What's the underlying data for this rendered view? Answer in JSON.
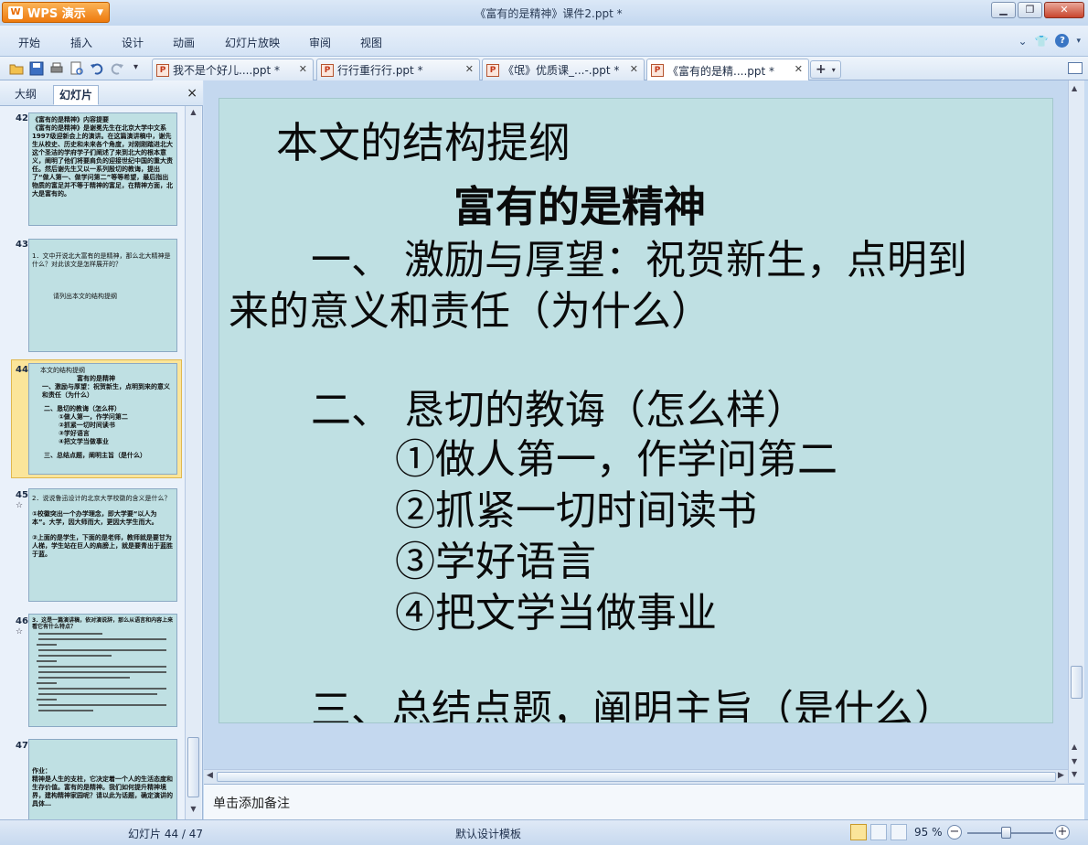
{
  "app": {
    "name": "WPS 演示",
    "window_title": "《富有的是精神》课件2.ppt *"
  },
  "menu": {
    "items": [
      "开始",
      "插入",
      "设计",
      "动画",
      "幻灯片放映",
      "审阅",
      "视图"
    ]
  },
  "doc_tabs": [
    {
      "label": "我不是个好儿....ppt *"
    },
    {
      "label": "行行重行行.ppt *"
    },
    {
      "label": "《氓》优质课_...-.ppt *"
    },
    {
      "label": "《富有的是精....ppt *"
    }
  ],
  "panel": {
    "tab_outline": "大纲",
    "tab_slides": "幻灯片",
    "close": "×"
  },
  "thumbnails": [
    {
      "number": "42",
      "lines": [
        "《富有的是精神》内容提要",
        "《富有的是精神》是谢冕先生在北京大学中文系1997级迎新会上的演讲。在这篇演讲稿中，谢先生从校史、历史和未来各个角度，对刚刚踏进北大这个圣洁的学府学子们阐述了来到北大的根本意义，阐明了他们将要肩负的迎接世纪中国的重大责任。然后谢先生又以一系列殷切的教诲，提出了“做人第一、做学问第二”等等希望，最后指出物质的富足并不等于精神的富足，在精神方面，北大是富有的。"
      ]
    },
    {
      "number": "43",
      "lines": [
        "1．文中开说北大富有的是精神，那么北大精神是什么？对此该文是怎样展开的？",
        "请列出本文的结构提纲"
      ]
    },
    {
      "number": "44",
      "lines": [
        "本文的结构提纲",
        "富有的是精神",
        "一、激励与厚望：祝贺新生，点明到来的意义和责任（为什么）",
        "二、恳切的教诲（怎么样）",
        "①做人第一，作学问第二",
        "②抓紧一切时间读书",
        "③学好语言",
        "④把文学当做事业",
        "三、总结点题，阐明主旨（是什么）"
      ]
    },
    {
      "number": "45",
      "lines": [
        "2．说说鲁迅设计的北京大学校徽的含义是什么？",
        "①校徽突出一个办学理念，即大学要“以人为本”。大学，因大师而大，更因大学生而大。",
        "②上面的是学生，下面的是老师，教师就是要甘为人梯，学生站在巨人的肩膀上，就是要青出于蓝胜于蓝。"
      ]
    },
    {
      "number": "46",
      "lines": [
        "3．这是一篇演讲稿，依对演说辞，那么从语言和内容上来看它有什么特点？"
      ]
    },
    {
      "number": "47",
      "lines": [
        "作业：",
        "精神是人生的支柱，它决定着一个人的生活态度和生存价值。富有的是精神。我们如何提升精神境界，建构精神家园呢？请以此为话题，确定演讲的具体…"
      ]
    }
  ],
  "slide": {
    "heading": "本文的结构提纲",
    "title": "富有的是精神",
    "section1_line1": "一、  激励与厚望：祝贺新生，点明到",
    "section1_line2": "来的意义和责任（为什么）",
    "section2": "二、  恳切的教诲（怎么样）",
    "point1": "①做人第一，作学问第二",
    "point2": "②抓紧一切时间读书",
    "point3": "③学好语言",
    "point4": "④把文学当做事业",
    "section3": "三、总结点题，阐明主旨（是什么）",
    "background_color": "#bfe0e3"
  },
  "notes": {
    "placeholder": "单击添加备注"
  },
  "status": {
    "slide_counter": "幻灯片 44 / 47",
    "template": "默认设计模板",
    "zoom": "95 %"
  }
}
